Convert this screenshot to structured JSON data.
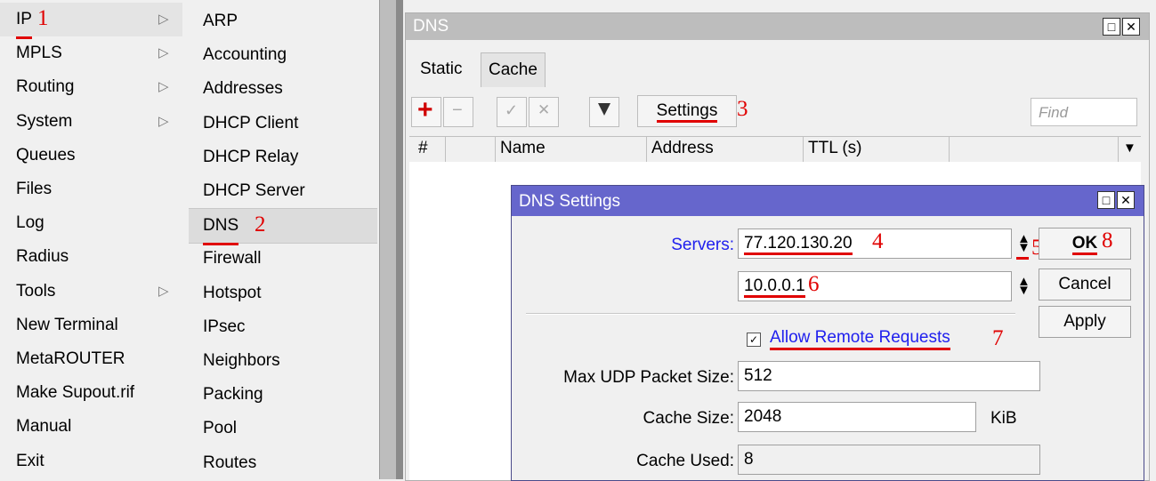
{
  "menu_main": {
    "items": [
      {
        "label": "IP",
        "marker": "1"
      },
      {
        "label": "MPLS"
      },
      {
        "label": "Routing"
      },
      {
        "label": "System"
      },
      {
        "label": "Queues"
      },
      {
        "label": "Files"
      },
      {
        "label": "Log"
      },
      {
        "label": "Radius"
      },
      {
        "label": "Tools"
      },
      {
        "label": "New Terminal"
      },
      {
        "label": "MetaROUTER"
      },
      {
        "label": "Make Supout.rif"
      },
      {
        "label": "Manual"
      },
      {
        "label": "Exit"
      }
    ],
    "submenu_arrow": "▷"
  },
  "menu_ip": {
    "items": [
      {
        "label": "ARP"
      },
      {
        "label": "Accounting"
      },
      {
        "label": "Addresses"
      },
      {
        "label": "DHCP Client"
      },
      {
        "label": "DHCP Relay"
      },
      {
        "label": "DHCP Server"
      },
      {
        "label": "DNS",
        "marker": "2"
      },
      {
        "label": "Firewall"
      },
      {
        "label": "Hotspot"
      },
      {
        "label": "IPsec"
      },
      {
        "label": "Neighbors"
      },
      {
        "label": "Packing"
      },
      {
        "label": "Pool"
      },
      {
        "label": "Routes"
      }
    ]
  },
  "dns_window": {
    "title": "DNS",
    "tabs": [
      "Static",
      "Cache"
    ],
    "toolbar": {
      "add": "+",
      "remove": "−",
      "enable": "✓",
      "disable": "✕",
      "filter": "▼",
      "settings_label": "Settings",
      "settings_marker": "3",
      "find_placeholder": "Find"
    },
    "columns": [
      "#",
      "Name",
      "Address",
      "TTL (s)"
    ],
    "dropdown_glyph": "▼"
  },
  "dns_settings": {
    "title": "DNS Settings",
    "servers_label": "Servers:",
    "server1": "77.120.130.20",
    "server1_marker": "4",
    "spin_marker": "5",
    "server2": "10.0.0.1",
    "server2_marker": "6",
    "allow_remote_label": "Allow Remote Requests",
    "allow_remote_checked": true,
    "allow_remote_marker": "7",
    "max_udp_label": "Max UDP Packet Size:",
    "max_udp_value": "512",
    "cache_size_label": "Cache Size:",
    "cache_size_value": "2048",
    "cache_size_unit": "KiB",
    "cache_used_label": "Cache Used:",
    "cache_used_value": "8",
    "ok_label": "OK",
    "ok_marker": "8",
    "cancel_label": "Cancel",
    "apply_label": "Apply"
  },
  "colors": {
    "dialog_title_bg": "#6666cc",
    "annotation_red": "#e00000",
    "link_blue": "#0000ee"
  }
}
